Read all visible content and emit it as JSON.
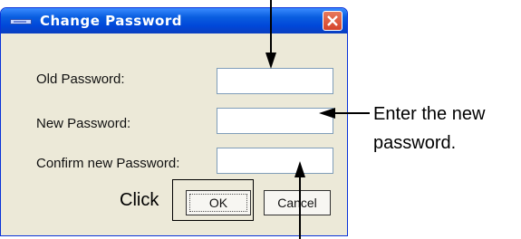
{
  "dialog": {
    "title": "Change Password",
    "fields": [
      {
        "label": "Old Password:",
        "value": ""
      },
      {
        "label": "New Password:",
        "value": ""
      },
      {
        "label": "Confirm new Password:",
        "value": ""
      }
    ],
    "ok_label": "OK",
    "cancel_label": "Cancel"
  },
  "annotations": {
    "click": "Click",
    "enter_line1": "Enter the new",
    "enter_line2": "password."
  }
}
